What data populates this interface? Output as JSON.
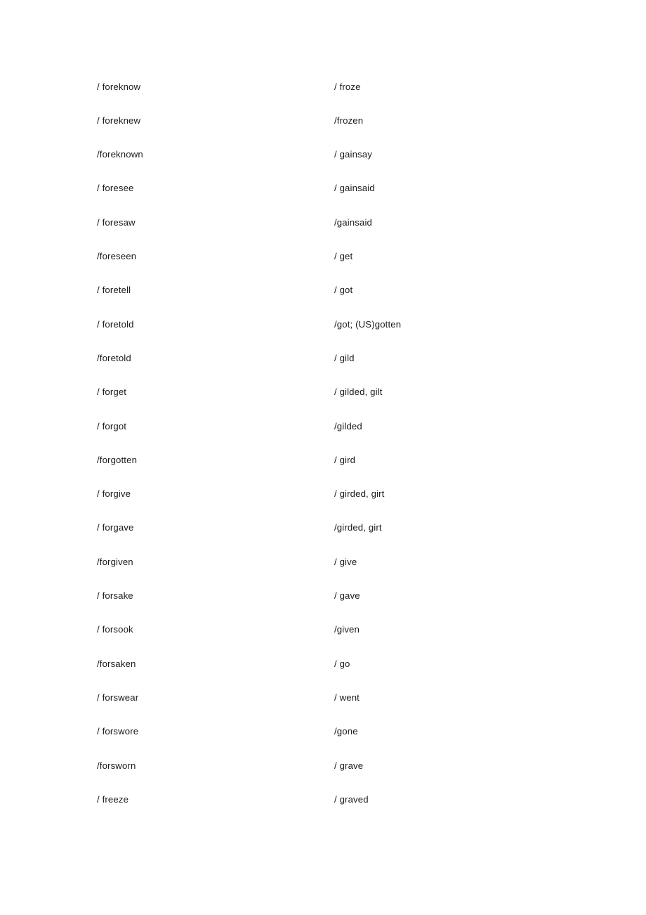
{
  "document": {
    "kind": "irregular-verbs-list",
    "columns": 2,
    "row_count": 22,
    "text_color": "#1a1a1a",
    "background_color": "#ffffff"
  },
  "rows": [
    {
      "left": "/ foreknow",
      "right": "/ froze"
    },
    {
      "left": "/ foreknew",
      "right": "/frozen"
    },
    {
      "left": "/foreknown",
      "right": "/ gainsay"
    },
    {
      "left": "/ foresee",
      "right": "/ gainsaid"
    },
    {
      "left": "/ foresaw",
      "right": "/gainsaid"
    },
    {
      "left": "/foreseen",
      "right": "/ get"
    },
    {
      "left": "/ foretell",
      "right": "/ got"
    },
    {
      "left": "/ foretold",
      "right": "/got; (US)gotten"
    },
    {
      "left": "/foretold",
      "right": "/ gild"
    },
    {
      "left": "/ forget",
      "right": "/ gilded, gilt"
    },
    {
      "left": "/ forgot",
      "right": "/gilded"
    },
    {
      "left": "/forgotten",
      "right": "/ gird"
    },
    {
      "left": "/ forgive",
      "right": "/ girded, girt"
    },
    {
      "left": "/ forgave",
      "right": "/girded, girt"
    },
    {
      "left": "/forgiven",
      "right": "/ give"
    },
    {
      "left": "/ forsake",
      "right": "/ gave"
    },
    {
      "left": "/ forsook",
      "right": "/given"
    },
    {
      "left": "/forsaken",
      "right": "/ go"
    },
    {
      "left": "/ forswear",
      "right": "/ went"
    },
    {
      "left": "/ forswore",
      "right": "/gone"
    },
    {
      "left": "/forsworn",
      "right": "/ grave"
    },
    {
      "left": "/ freeze",
      "right": "/ graved"
    }
  ]
}
